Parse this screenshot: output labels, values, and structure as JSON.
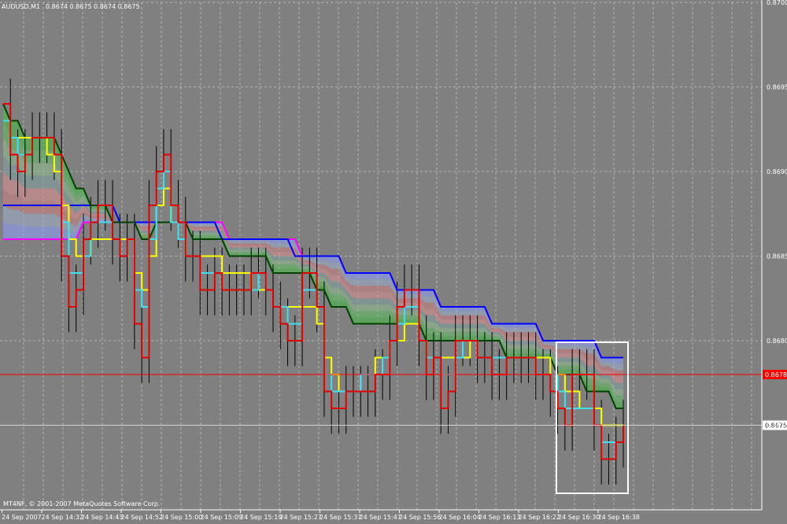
{
  "header": {
    "symbol": "AUDUSD,M1",
    "quote": "0.8674 0.8675 0.8674 0.8675"
  },
  "footer": {
    "copyright": "MT4NF, © 2001-2007 MetaQuotes Software Corp."
  },
  "colors": {
    "background": "#808080",
    "grid": "#b4b4b4",
    "axis_text": "#ffffff",
    "price_line": "#ff0000",
    "bid_label_bg": "#ff0000",
    "candle": "#000000",
    "highlight_box": "#ffffff",
    "red_line": "#e00000",
    "cyan_line": "#40e0f0",
    "yellow_line": "#ffff00",
    "dark_green_line": "#004000",
    "magenta_line": "#ff00ff",
    "blue_line": "#0000ff"
  },
  "chart_data": {
    "type": "line",
    "title": "AUDUSD,M1",
    "ylim": [
      0.867,
      0.87
    ],
    "y_ticks": [
      "0.8700",
      "0.8695",
      "0.8690",
      "0.8685",
      "0.8680",
      "0.8675"
    ],
    "x_ticks": [
      "24 Sep 2007",
      "24 Sep 14:32",
      "24 Sep 14:43",
      "24 Sep 14:52",
      "24 Sep 15:00",
      "24 Sep 15:09",
      "24 Sep 15:19",
      "24 Sep 15:27",
      "24 Sep 15:37",
      "24 Sep 15:47",
      "24 Sep 15:56",
      "24 Sep 16:04",
      "24 Sep 16:13",
      "24 Sep 16:22",
      "24 Sep 16:30",
      "24 Sep 16:38"
    ],
    "current_price_label": "0.8678",
    "horizontal_line_label": "0.8675",
    "grid": true,
    "series": [
      {
        "color": "#e00000",
        "values": [
          0.8694,
          0.8691,
          0.869,
          0.8691,
          0.8692,
          0.8692,
          0.8692,
          0.8691,
          0.8685,
          0.8682,
          0.8683,
          0.8686,
          0.8687,
          0.8688,
          0.8688,
          0.8686,
          0.8685,
          0.8686,
          0.8681,
          0.8679,
          0.8688,
          0.869,
          0.8691,
          0.8688,
          0.8687,
          0.8685,
          0.8685,
          0.8683,
          0.8683,
          0.8684,
          0.8683,
          0.8683,
          0.8683,
          0.8683,
          0.8684,
          0.8684,
          0.8683,
          0.8682,
          0.8681,
          0.868,
          0.868,
          0.8684,
          0.8684,
          0.8682,
          0.8677,
          0.8676,
          0.8676,
          0.8677,
          0.8677,
          0.8677,
          0.8677,
          0.8678,
          0.8678,
          0.868,
          0.8682,
          0.8683,
          0.8683,
          0.868,
          0.8678,
          0.8679,
          0.8676,
          0.8677,
          0.868,
          0.868,
          0.868,
          0.8679,
          0.8679,
          0.8678,
          0.8678,
          0.8679,
          0.8679,
          0.8679,
          0.8679,
          0.8678,
          0.8678,
          0.8677,
          0.8676,
          0.8675,
          0.8678,
          0.8678,
          0.8678,
          0.8675,
          0.8673,
          0.8673,
          0.8674,
          0.8675
        ]
      },
      {
        "color": "#40e0f0",
        "values": [
          0.8693,
          0.8692,
          0.8691,
          0.8691,
          0.8692,
          0.8692,
          0.8692,
          0.8691,
          0.8687,
          0.8684,
          0.8684,
          0.8685,
          0.8687,
          0.8687,
          0.8687,
          0.8686,
          0.8685,
          0.8686,
          0.8683,
          0.8682,
          0.8686,
          0.8689,
          0.869,
          0.8687,
          0.8686,
          0.8685,
          0.8685,
          0.8684,
          0.8684,
          0.8684,
          0.8683,
          0.8683,
          0.8683,
          0.8683,
          0.8683,
          0.8684,
          0.8683,
          0.8682,
          0.8682,
          0.8681,
          0.8681,
          0.8683,
          0.8683,
          0.8682,
          0.8678,
          0.8677,
          0.8677,
          0.8677,
          0.8677,
          0.8678,
          0.8678,
          0.8678,
          0.8679,
          0.868,
          0.8681,
          0.8682,
          0.8682,
          0.868,
          0.8679,
          0.8679,
          0.8678,
          0.8678,
          0.8679,
          0.868,
          0.868,
          0.8679,
          0.8679,
          0.8679,
          0.8679,
          0.8679,
          0.8679,
          0.8679,
          0.8679,
          0.8678,
          0.8678,
          0.8678,
          0.8677,
          0.8676,
          0.8676,
          0.8676,
          0.8676,
          0.8675,
          0.8674,
          0.8674,
          0.8674,
          0.8675
        ]
      },
      {
        "color": "#ffff00",
        "values": [
          0.8693,
          0.8692,
          0.8692,
          0.8692,
          0.8692,
          0.8692,
          0.8691,
          0.869,
          0.8688,
          0.8686,
          0.8685,
          0.8685,
          0.8686,
          0.8686,
          0.8686,
          0.8686,
          0.8686,
          0.8686,
          0.8684,
          0.8683,
          0.8685,
          0.8688,
          0.8689,
          0.8687,
          0.8686,
          0.8685,
          0.8685,
          0.8685,
          0.8685,
          0.8685,
          0.8684,
          0.8684,
          0.8684,
          0.8684,
          0.8683,
          0.8683,
          0.8683,
          0.8682,
          0.8682,
          0.8682,
          0.8682,
          0.8682,
          0.8682,
          0.8681,
          0.8679,
          0.8678,
          0.8677,
          0.8677,
          0.8677,
          0.8678,
          0.8678,
          0.8679,
          0.8679,
          0.868,
          0.868,
          0.8681,
          0.8681,
          0.868,
          0.8679,
          0.8679,
          0.8679,
          0.8679,
          0.8679,
          0.8679,
          0.868,
          0.8679,
          0.8679,
          0.8679,
          0.8679,
          0.8679,
          0.8679,
          0.8679,
          0.8679,
          0.8679,
          0.8679,
          0.8678,
          0.8678,
          0.8677,
          0.8677,
          0.8676,
          0.8676,
          0.8676,
          0.8675,
          0.8675,
          0.8675,
          0.8675
        ]
      },
      {
        "color": "#004000",
        "values": [
          0.8694,
          0.8693,
          0.8693,
          0.8692,
          0.8692,
          0.8692,
          0.8692,
          0.8692,
          0.8691,
          0.869,
          0.8689,
          0.8689,
          0.8688,
          0.8688,
          0.8688,
          0.8687,
          0.8687,
          0.8687,
          0.8687,
          0.8686,
          0.8686,
          0.8687,
          0.8687,
          0.8687,
          0.8687,
          0.8687,
          0.8686,
          0.8686,
          0.8686,
          0.8686,
          0.8686,
          0.8685,
          0.8685,
          0.8685,
          0.8685,
          0.8685,
          0.8685,
          0.8684,
          0.8684,
          0.8684,
          0.8684,
          0.8684,
          0.8684,
          0.8683,
          0.8683,
          0.8682,
          0.8682,
          0.8682,
          0.8681,
          0.8681,
          0.8681,
          0.8681,
          0.8681,
          0.8681,
          0.8681,
          0.8681,
          0.8681,
          0.8681,
          0.868,
          0.868,
          0.868,
          0.868,
          0.868,
          0.868,
          0.868,
          0.868,
          0.868,
          0.868,
          0.868,
          0.8679,
          0.8679,
          0.8679,
          0.8679,
          0.8679,
          0.8679,
          0.8679,
          0.8678,
          0.8678,
          0.8678,
          0.8678,
          0.8677,
          0.8677,
          0.8677,
          0.8677,
          0.8676,
          0.8676
        ]
      },
      {
        "color": "#ff00ff",
        "values": [
          0.8686,
          0.8686,
          0.8686,
          0.8686,
          0.8686,
          0.8686,
          0.8686,
          0.8686,
          0.8686,
          0.8686,
          0.8686,
          0.8687,
          0.8687,
          0.8687,
          0.8687,
          0.8687,
          0.8687,
          0.8687,
          0.8687,
          0.8687,
          0.8687,
          0.8687,
          0.8687,
          0.8687,
          0.8687,
          0.8687,
          0.8687,
          0.8687,
          0.8687,
          0.8687,
          0.8687,
          0.8686,
          0.8686,
          0.8686,
          0.8686,
          0.8686,
          0.8686,
          0.8686,
          0.8686,
          0.8686,
          0.8686,
          0.8685,
          0.8685,
          0.8685,
          0.8685,
          0.8685,
          0.8685,
          0.8684,
          0.8684,
          0.8684,
          0.8684,
          0.8684,
          0.8684,
          0.8684,
          0.8683,
          0.8683,
          0.8683,
          0.8683,
          0.8683,
          0.8683,
          0.8682,
          0.8682,
          0.8682,
          0.8682,
          0.8682,
          0.8682,
          0.8682,
          0.8681,
          0.8681,
          0.8681,
          0.8681,
          0.8681,
          0.8681,
          0.8681,
          0.868,
          0.868,
          0.868,
          0.868,
          0.868,
          0.868,
          0.868,
          0.868,
          0.8679,
          0.8679,
          0.8679,
          0.8679
        ]
      },
      {
        "color": "#0000ff",
        "values": [
          0.8688,
          0.8688,
          0.8688,
          0.8688,
          0.8688,
          0.8688,
          0.8688,
          0.8688,
          0.8688,
          0.8688,
          0.8688,
          0.8688,
          0.8688,
          0.8688,
          0.8688,
          0.8688,
          0.8687,
          0.8687,
          0.8687,
          0.8687,
          0.8687,
          0.8687,
          0.8687,
          0.8687,
          0.8687,
          0.8687,
          0.8687,
          0.8687,
          0.8687,
          0.8687,
          0.8686,
          0.8686,
          0.8686,
          0.8686,
          0.8686,
          0.8686,
          0.8686,
          0.8686,
          0.8686,
          0.8686,
          0.8685,
          0.8685,
          0.8685,
          0.8685,
          0.8685,
          0.8685,
          0.8685,
          0.8684,
          0.8684,
          0.8684,
          0.8684,
          0.8684,
          0.8684,
          0.8684,
          0.8683,
          0.8683,
          0.8683,
          0.8683,
          0.8683,
          0.8683,
          0.8682,
          0.8682,
          0.8682,
          0.8682,
          0.8682,
          0.8682,
          0.8682,
          0.8681,
          0.8681,
          0.8681,
          0.8681,
          0.8681,
          0.8681,
          0.8681,
          0.868,
          0.868,
          0.868,
          0.868,
          0.868,
          0.868,
          0.868,
          0.868,
          0.8679,
          0.8679,
          0.8679,
          0.8679
        ]
      }
    ]
  }
}
